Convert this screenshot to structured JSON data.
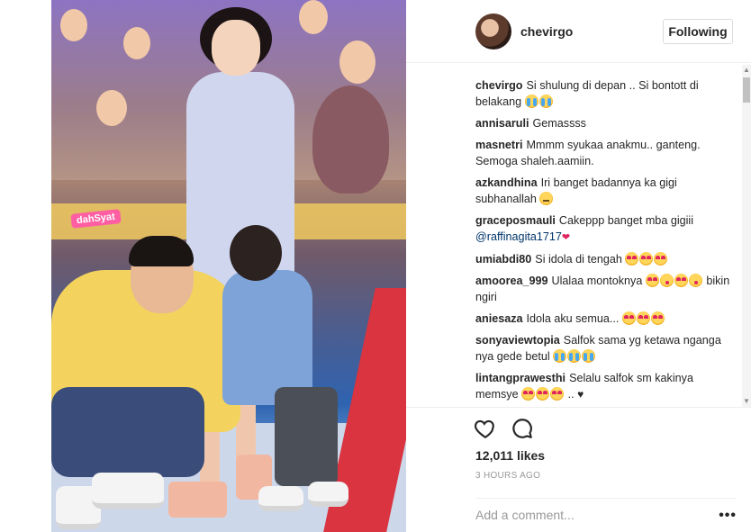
{
  "post": {
    "photo_logo": "dahSyat",
    "username": "chevirgo",
    "follow_label": "Following",
    "likes": "12,011 likes",
    "timestamp": "3 HOURS AGO",
    "add_comment_placeholder": "Add a comment...",
    "more_label": "•••"
  },
  "comments": [
    {
      "user": "chevirgo",
      "text": "Si shulung di depan .. Si bontott di belakang",
      "emojis": [
        "cry",
        "cry"
      ]
    },
    {
      "user": "annisaruli",
      "text": "Gemassss",
      "emojis": []
    },
    {
      "user": "masnetri",
      "text": "Mmmm syukaa anakmu.. ganteng. Semoga shaleh.aamiin.",
      "emojis": []
    },
    {
      "user": "azkandhina",
      "text": "Iri banget badannya ka gigi subhanallah",
      "emojis": [
        "neutral"
      ]
    },
    {
      "user": "graceposmauli",
      "text": "Cakeppp banget mba gigiii",
      "mention": "@raffinagita1717",
      "trailing_heart": true,
      "emojis": []
    },
    {
      "user": "umiabdi80",
      "text": "Si idola di tengah",
      "emojis": [
        "heart-eyes",
        "heart-eyes",
        "heart-eyes"
      ]
    },
    {
      "user": "amoorea_999",
      "text": "Ulalaa montoknya",
      "emojis": [
        "heart-eyes",
        "kiss",
        "heart-eyes",
        "kiss"
      ],
      "text_after": "bikin ngiri"
    },
    {
      "user": "aniesaza",
      "text": "Idola aku semua...",
      "emojis": [
        "heart-eyes",
        "heart-eyes",
        "heart-eyes"
      ]
    },
    {
      "user": "sonyaviewtopia",
      "text": "Salfok sama yg ketawa nganga nya gede betul",
      "emojis": [
        "cry",
        "cry",
        "cry"
      ]
    },
    {
      "user": "lintangprawesthi",
      "text": "Selalu salfok sm kakinya memsye",
      "emojis": [
        "heart-eyes",
        "heart-eyes",
        "heart-eyes"
      ],
      "text_after": "..",
      "trailing_black_heart": true
    }
  ],
  "icons": {
    "like": "heart-outline-icon",
    "comment": "speech-bubble-icon"
  },
  "colors": {
    "text": "#262626",
    "muted": "#999999",
    "mention": "#003569",
    "border": "#efefef"
  }
}
